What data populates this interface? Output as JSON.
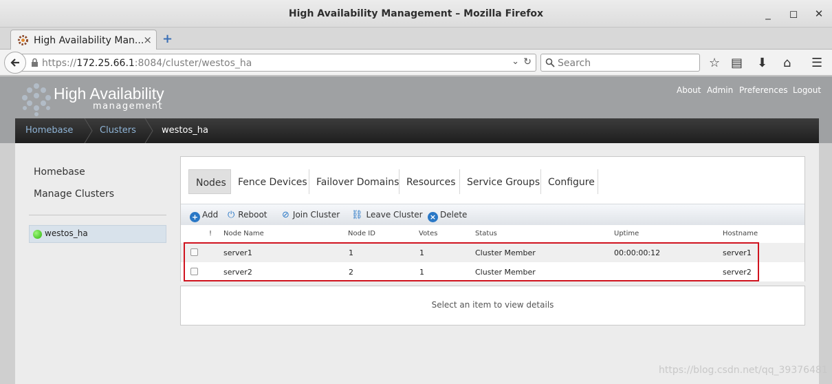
{
  "window": {
    "title": "High Availability Management – Mozilla Firefox"
  },
  "tab": {
    "label": "High Availability Man...",
    "close": "×",
    "new_tab": "+"
  },
  "navbar": {
    "url_scheme": "https://",
    "url_host": "172.25.66.1",
    "url_rest": ":8084/cluster/westos_ha",
    "search_placeholder": "Search"
  },
  "app": {
    "logo_main": "High Availability",
    "logo_sub": "management",
    "top_links": [
      "About",
      "Admin",
      "Preferences",
      "Logout"
    ],
    "breadcrumb": [
      "Homebase",
      "Clusters",
      "westos_ha"
    ]
  },
  "sidebar": {
    "links": [
      "Homebase",
      "Manage Clusters"
    ],
    "cluster": {
      "name": "westos_ha",
      "status_color": "#2eb80d"
    }
  },
  "tabs": [
    "Nodes",
    "Fence Devices",
    "Failover Domains",
    "Resources",
    "Service Groups",
    "Configure"
  ],
  "actions": [
    "Add",
    "Reboot",
    "Join Cluster",
    "Leave Cluster",
    "Delete"
  ],
  "table": {
    "headers": [
      "!",
      "Node Name",
      "Node ID",
      "Votes",
      "Status",
      "Uptime",
      "Hostname"
    ],
    "rows": [
      {
        "name": "server1",
        "id": "1",
        "votes": "1",
        "status": "Cluster Member",
        "uptime": "00:00:00:12",
        "hostname": "server1"
      },
      {
        "name": "server2",
        "id": "2",
        "votes": "1",
        "status": "Cluster Member",
        "uptime": "",
        "hostname": "server2"
      }
    ]
  },
  "details": {
    "placeholder": "Select an item to view details"
  },
  "watermark": "https://blog.csdn.net/qq_39376481",
  "colors": {
    "highlight": "#d0121e",
    "link": "#8fb4d6",
    "accent": "#2a78c6"
  }
}
